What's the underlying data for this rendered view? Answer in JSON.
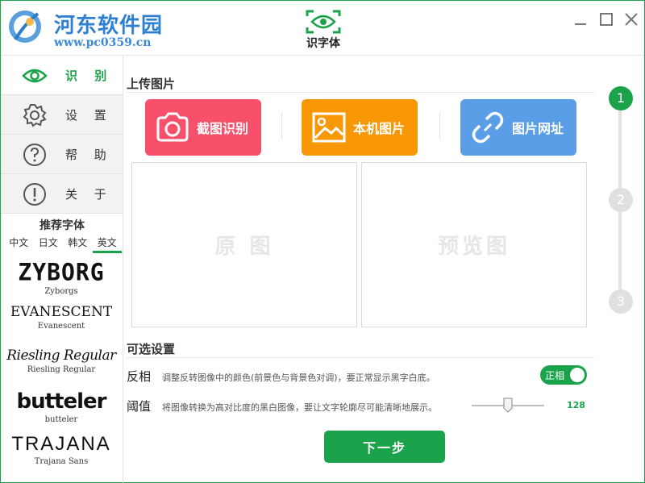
{
  "watermark": {
    "title": "河东软件园",
    "url": "www.pc0359.cn"
  },
  "app": {
    "name": "识字体"
  },
  "sidebar": {
    "items": [
      {
        "label": "识 别",
        "icon": "eye-icon",
        "active": true
      },
      {
        "label": "设 置",
        "icon": "gear-icon",
        "active": false
      },
      {
        "label": "帮 助",
        "icon": "question-icon",
        "active": false
      },
      {
        "label": "关 于",
        "icon": "info-icon",
        "active": false
      }
    ],
    "recommend": {
      "title": "推荐字体",
      "tabs": [
        "中文",
        "日文",
        "韩文",
        "英文"
      ],
      "active_tab": "英文",
      "fonts": [
        {
          "sample": "ZYBORG",
          "name": "Zyborgs"
        },
        {
          "sample": "EVANESCENT",
          "name": "Evanescent"
        },
        {
          "sample": "Riesling Regular",
          "name": "Riesling Regular"
        },
        {
          "sample": "butteler",
          "name": "butteler"
        },
        {
          "sample": "TRAJANA",
          "name": "Trajana Sans"
        }
      ]
    }
  },
  "main": {
    "upload_title": "上传图片",
    "buttons": {
      "screenshot": "截图识别",
      "local": "本机图片",
      "url": "图片网址"
    },
    "panels": {
      "original": "原 图",
      "preview": "预览图"
    },
    "options_title": "可选设置",
    "invert": {
      "label": "反相",
      "desc": "调整反转图像中的颜色(前景色与背景色对调)，要正常显示黑字白底。",
      "toggle_label": "正相",
      "enabled": true
    },
    "threshold": {
      "label": "阈值",
      "desc": "将图像转换为高对比度的黑白图像，要让文字轮廓尽可能清晰地展示。",
      "value": "128",
      "value_fraction": 0.5
    },
    "next_label": "下一步"
  },
  "steps": [
    "1",
    "2",
    "3"
  ],
  "colors": {
    "accent": "#1aa34a",
    "red": "#f7506a",
    "orange": "#f89806",
    "blue": "#5b9ee8"
  }
}
